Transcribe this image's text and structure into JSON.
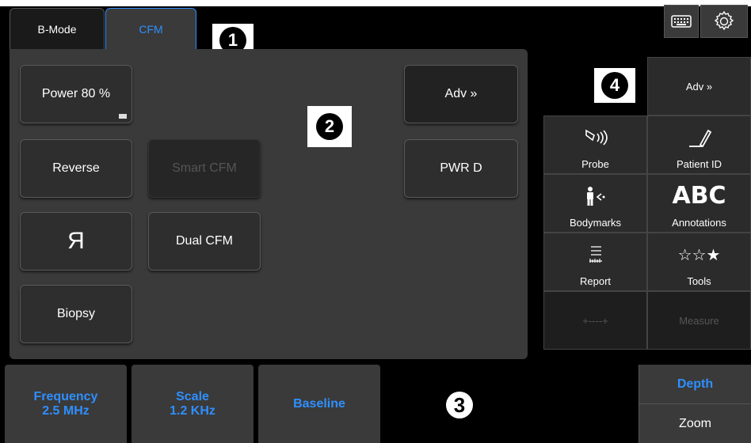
{
  "tabs": [
    {
      "label": "B-Mode",
      "active": false
    },
    {
      "label": "CFM",
      "active": true
    }
  ],
  "callouts": [
    "1",
    "2",
    "3",
    "4"
  ],
  "panel": {
    "power_label": "Power 80 %",
    "reverse_label": "Reverse",
    "smart_cfm_label": "Smart CFM",
    "invert_label": "Я",
    "dual_cfm_label": "Dual CFM",
    "biopsy_label": "Biopsy",
    "adv_label": "Adv »",
    "pwrd_label": "PWR D"
  },
  "right": {
    "adv_label": "Adv »",
    "cells": [
      {
        "label": "Probe",
        "icon": "probe-icon"
      },
      {
        "label": "Patient ID",
        "icon": "pen-icon"
      },
      {
        "label": "Bodymarks",
        "icon": "bodymark-icon"
      },
      {
        "label": "Annotations",
        "icon_text": "ABC"
      },
      {
        "label": "Report",
        "icon": "report-icon"
      },
      {
        "label": "Tools",
        "icon_text": "☆☆★"
      },
      {
        "label": "+----+",
        "disabled": true
      },
      {
        "label": "Measure",
        "disabled": true
      }
    ]
  },
  "bottom": {
    "frequency_label": "Frequency",
    "frequency_value": "2.5 MHz",
    "scale_label": "Scale",
    "scale_value": "1.2 KHz",
    "baseline_label": "Baseline",
    "depth_label": "Depth",
    "zoom_label": "Zoom"
  },
  "colors": {
    "accent": "#2f8fff",
    "panel": "#3a3a3a"
  }
}
